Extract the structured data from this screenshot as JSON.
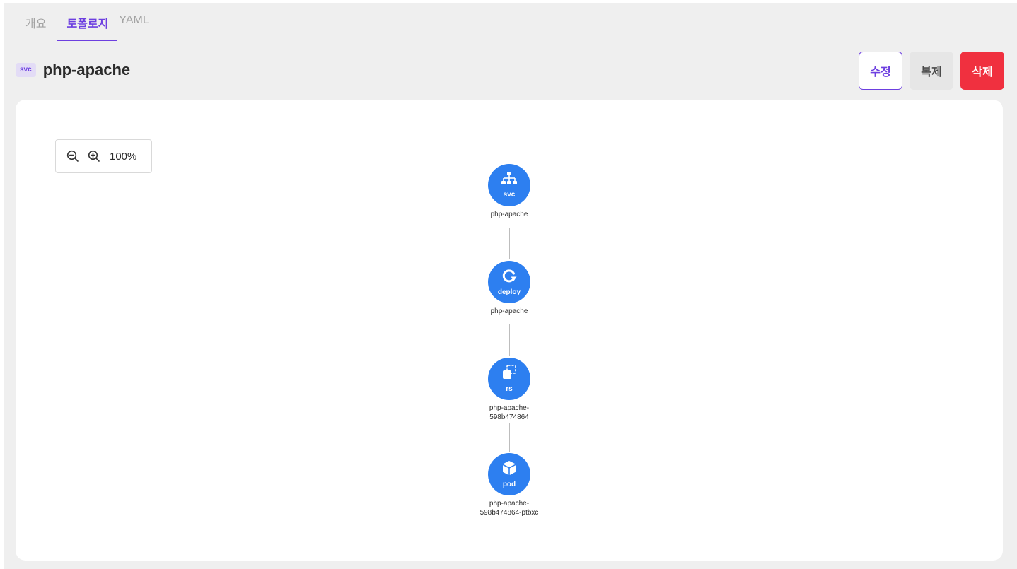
{
  "tabs": [
    {
      "label": "개요"
    },
    {
      "label": "토폴로지"
    },
    {
      "label": "YAML"
    }
  ],
  "header": {
    "kind_badge": "svc",
    "title": "php-apache"
  },
  "actions": {
    "edit_label": "수정",
    "copy_label": "복제",
    "delete_label": "삭제"
  },
  "zoom": {
    "level": "100%",
    "zoom_out_icon": "zoom-out-icon",
    "zoom_in_icon": "zoom-in-icon"
  },
  "nodes": [
    {
      "kind": "svc",
      "name_line1": "php-apache",
      "name_line2": "",
      "icon": "sitemap-icon"
    },
    {
      "kind": "deploy",
      "name_line1": "php-apache",
      "name_line2": "",
      "icon": "rotate-icon"
    },
    {
      "kind": "rs",
      "name_line1": "php-apache-",
      "name_line2": "598b474864",
      "icon": "copy-icon"
    },
    {
      "kind": "pod",
      "name_line1": "php-apache-",
      "name_line2": "598b474864-ptbxc",
      "icon": "cube-icon"
    }
  ],
  "colors": {
    "accent": "#6d3fe0",
    "node": "#2d7ff0",
    "danger": "#f0303f"
  }
}
